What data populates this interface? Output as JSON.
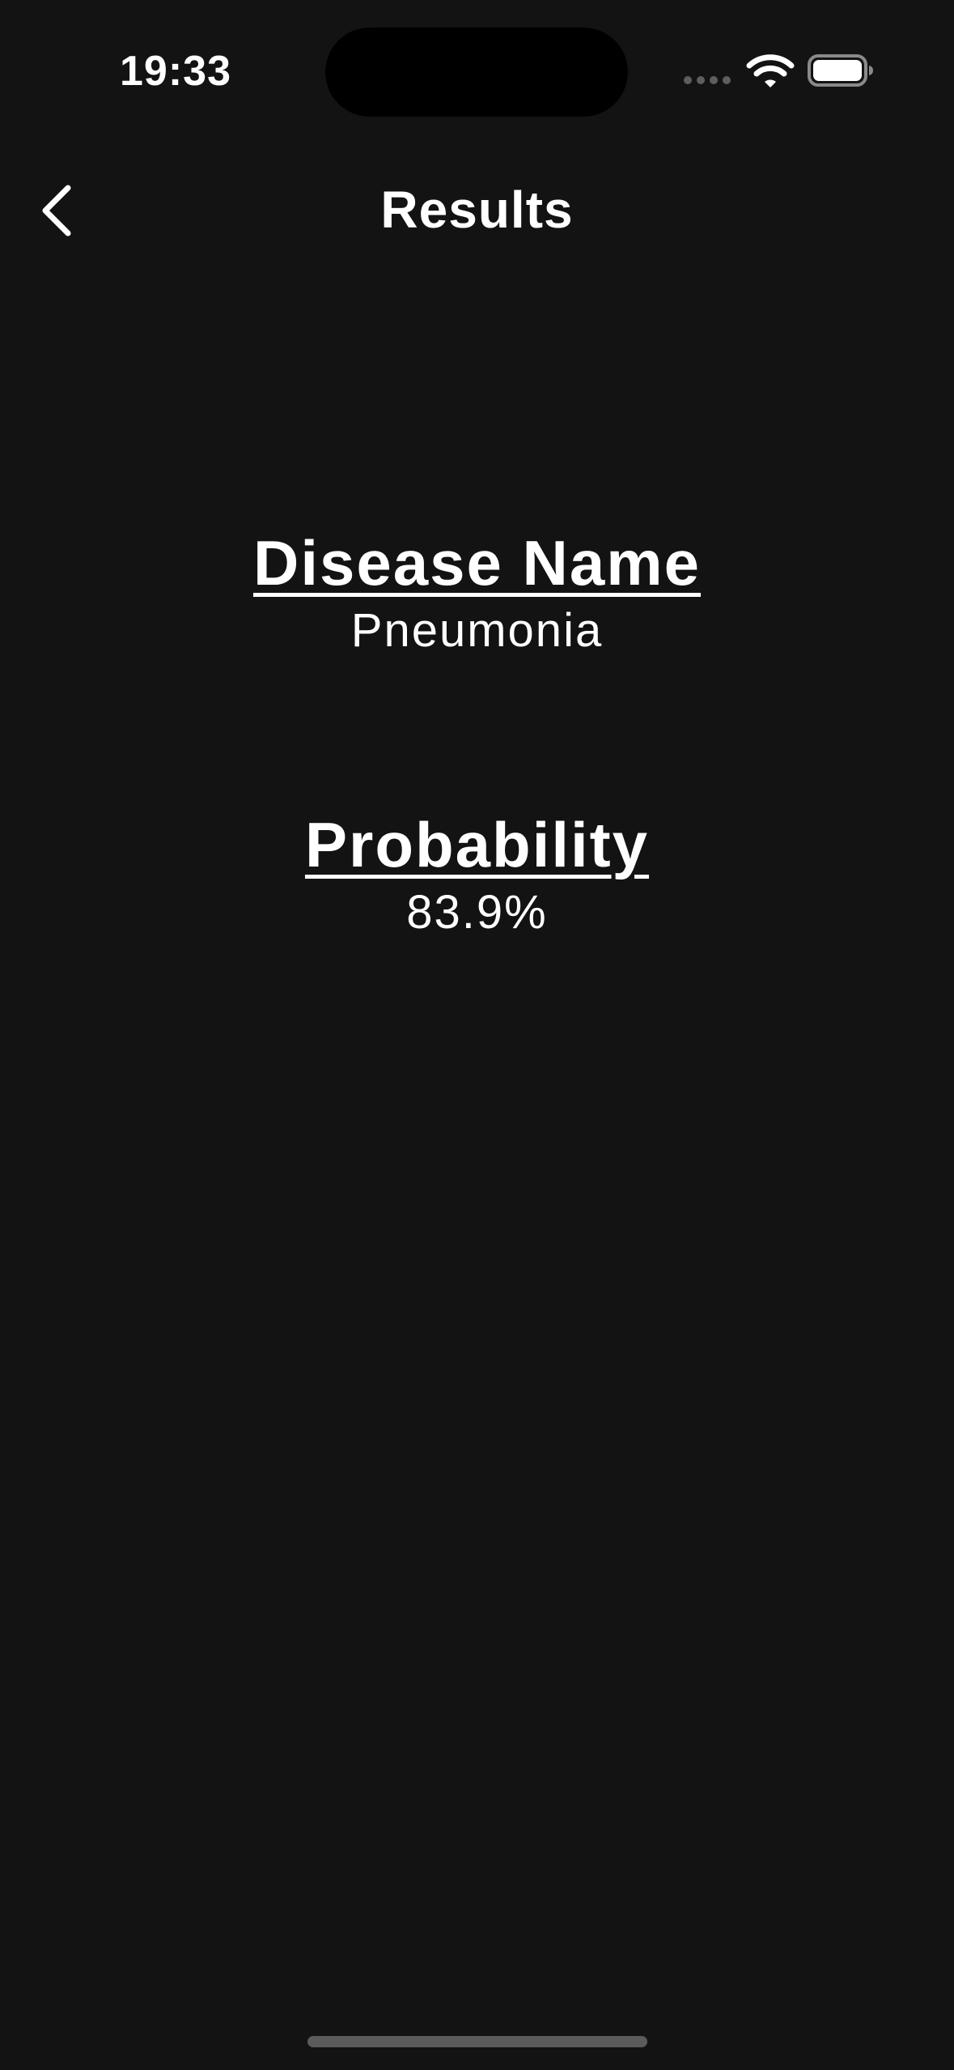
{
  "status_bar": {
    "time": "19:33",
    "signal_icon": "cellular-signal-icon",
    "wifi_icon": "wifi-icon",
    "battery_icon": "battery-icon"
  },
  "nav": {
    "title": "Results",
    "back_icon": "chevron-left-icon"
  },
  "results": {
    "disease_heading": "Disease Name",
    "disease_value": "Pneumonia",
    "probability_heading": "Probability",
    "probability_value": "83.9%"
  },
  "colors": {
    "background": "#131313",
    "text": "#ffffff",
    "island": "#000000",
    "muted": "#5e5e5e"
  }
}
